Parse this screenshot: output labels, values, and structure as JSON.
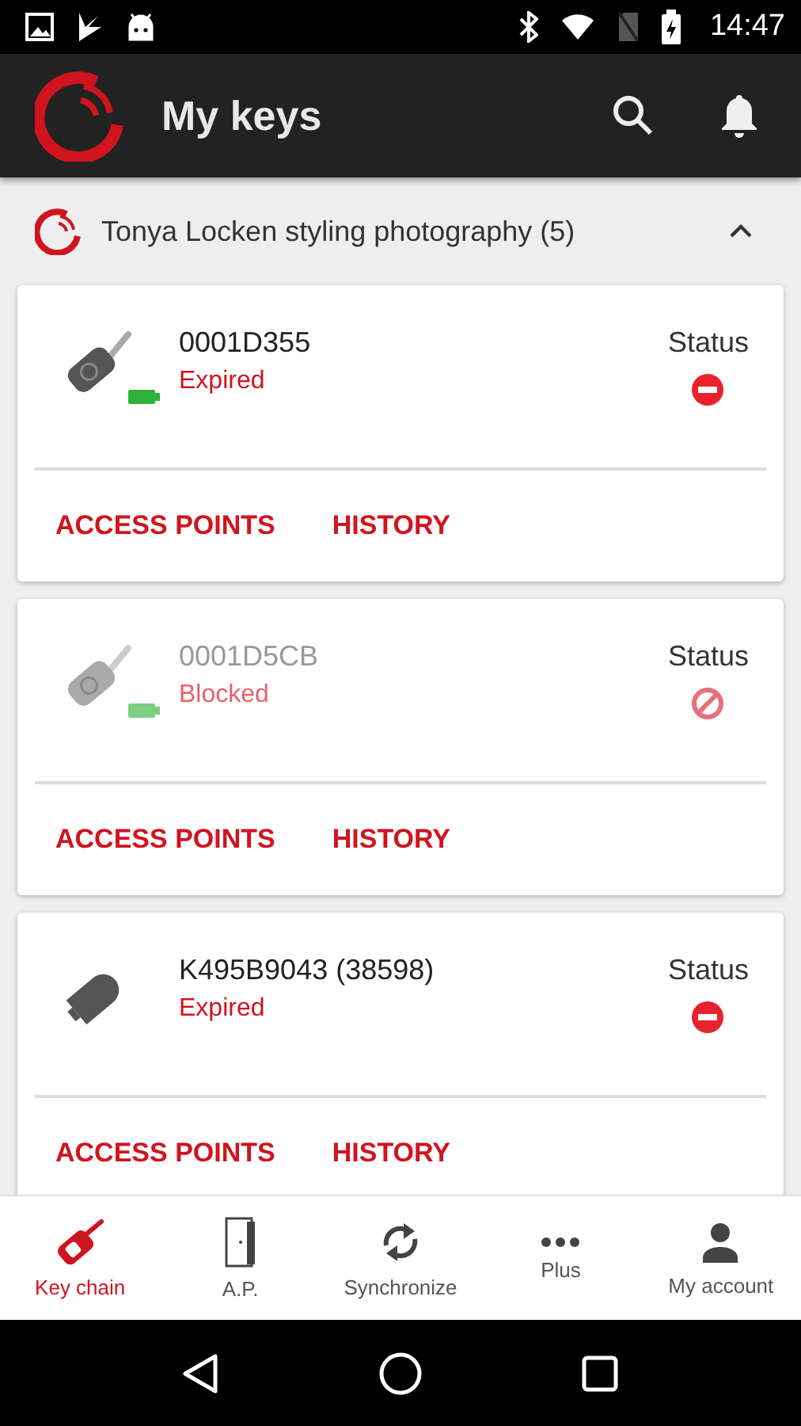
{
  "status_bar": {
    "time": "14:47"
  },
  "app_bar": {
    "title": "My keys"
  },
  "group": {
    "title": "Tonya Locken styling photography (5)",
    "expanded": true
  },
  "keys": [
    {
      "kind": "fob",
      "battery": true,
      "id": "0001D355",
      "state": "Expired",
      "status": {
        "label": "Status",
        "kind": "expired"
      },
      "disabled": false,
      "actions": [
        "ACCESS POINTS",
        "HISTORY"
      ]
    },
    {
      "kind": "fob",
      "battery": true,
      "id": "0001D5CB",
      "state": "Blocked",
      "status": {
        "label": "Status",
        "kind": "blocked"
      },
      "disabled": true,
      "actions": [
        "ACCESS POINTS",
        "HISTORY"
      ]
    },
    {
      "kind": "remote",
      "battery": false,
      "id": "K495B9043 (38598)",
      "state": "Expired",
      "status": {
        "label": "Status",
        "kind": "expired"
      },
      "disabled": false,
      "actions": [
        "ACCESS POINTS",
        "HISTORY"
      ]
    }
  ],
  "bottom_nav": [
    {
      "kind": "keychain",
      "label": "Key chain",
      "selected": true
    },
    {
      "kind": "door",
      "label": "A.P.",
      "selected": false
    },
    {
      "kind": "sync",
      "label": "Synchronize",
      "selected": false
    },
    {
      "kind": "more",
      "label": "Plus",
      "selected": false
    },
    {
      "kind": "account",
      "label": "My account",
      "selected": false
    }
  ]
}
